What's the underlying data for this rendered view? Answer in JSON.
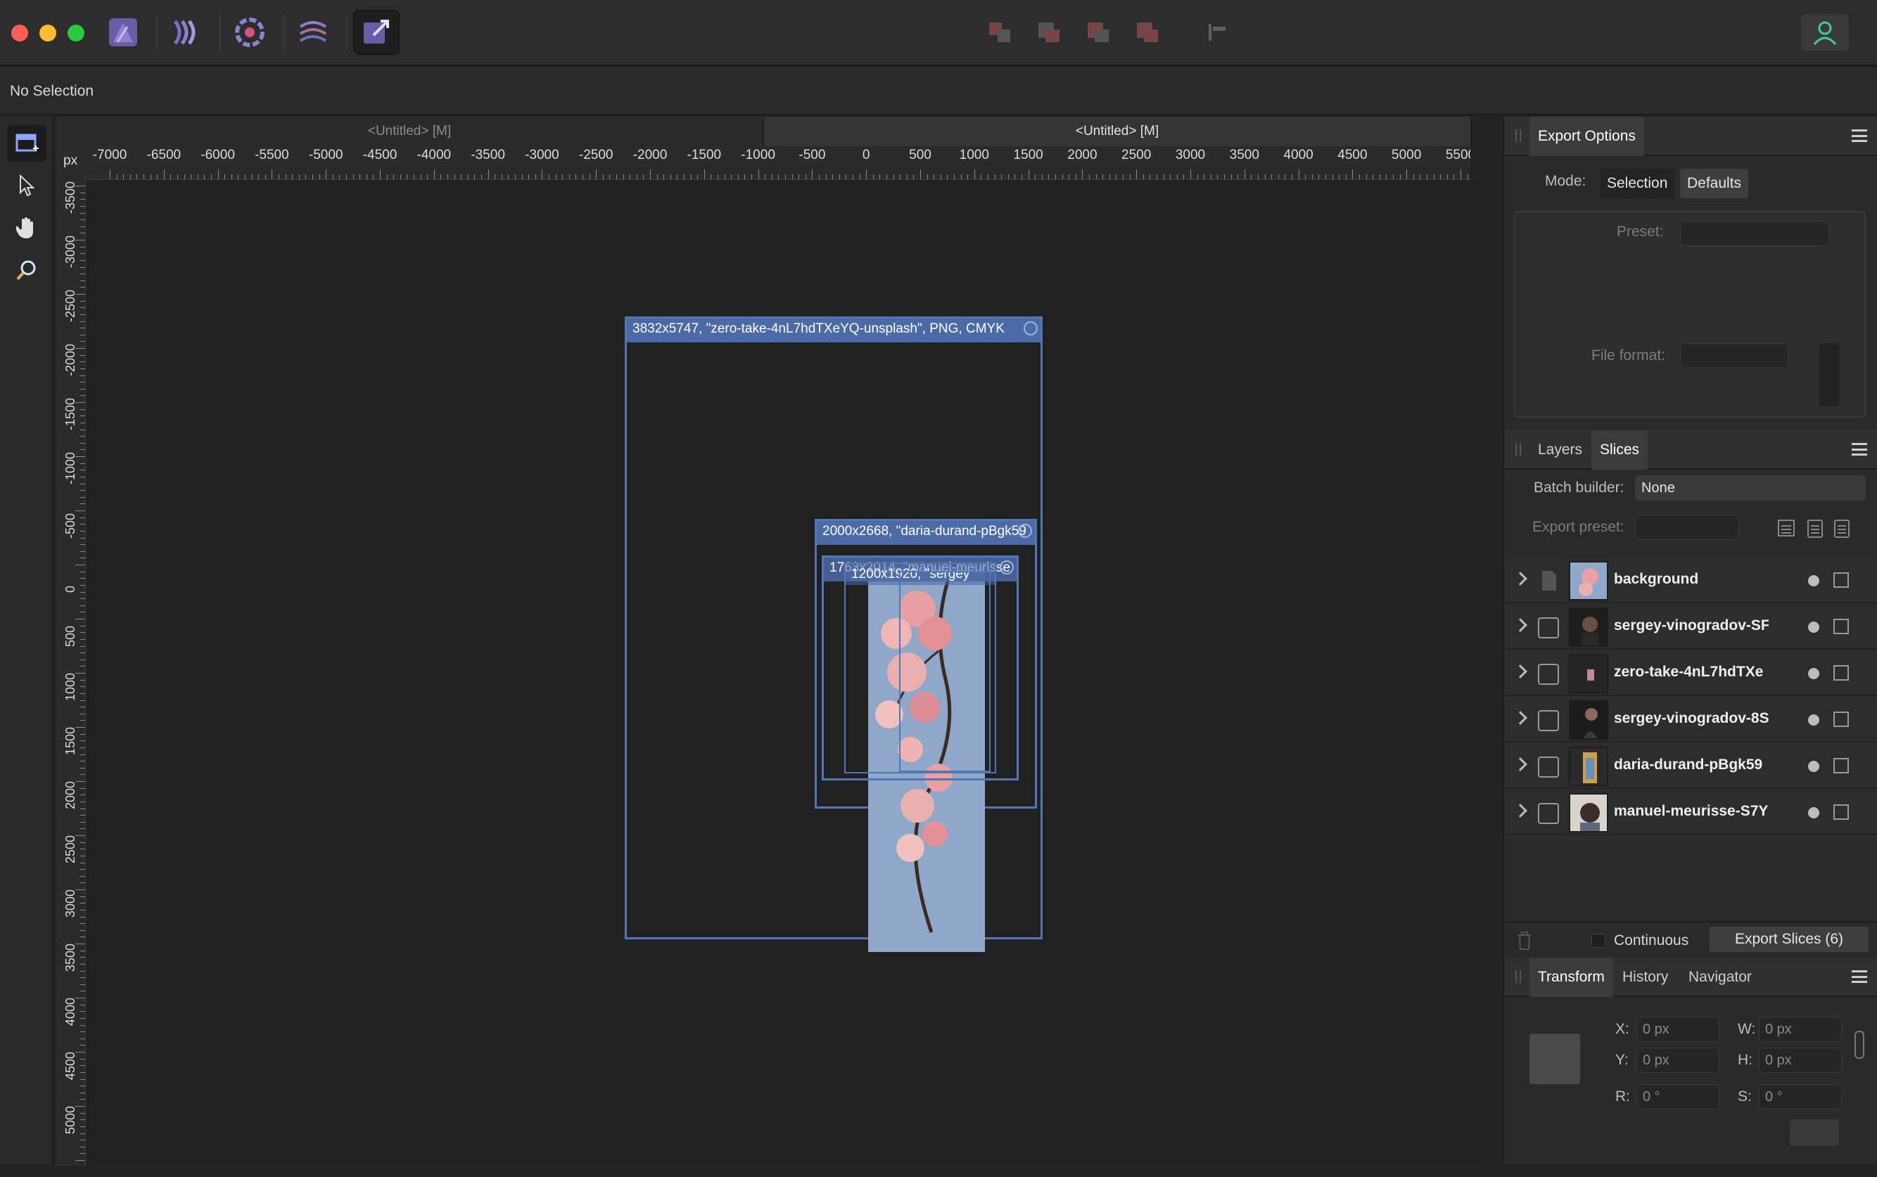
{
  "toolbar": {
    "personas": [
      "photo-persona",
      "liquify-persona",
      "develop-persona",
      "tone-mapping-persona",
      "export-persona"
    ]
  },
  "context": {
    "status": "No Selection"
  },
  "documents": {
    "tabs": [
      "<Untitled> [M]",
      "<Untitled> [M]"
    ],
    "ruler_unit": "px",
    "ruler_x": [
      "-7000",
      "-6500",
      "-6000",
      "-5500",
      "-5000",
      "-4500",
      "-4000",
      "-3500",
      "-3000",
      "-2500",
      "-2000",
      "-1500",
      "-1000",
      "-500",
      "0",
      "500",
      "1000",
      "1500",
      "2000",
      "2500",
      "3000",
      "3500",
      "4000",
      "4500",
      "5000",
      "5500"
    ],
    "ruler_y": [
      "-3500",
      "-3000",
      "-2500",
      "-2000",
      "-1500",
      "-1000",
      "-500",
      "0",
      "500",
      "1000",
      "1500",
      "2000",
      "2500",
      "3000",
      "3500",
      "4000",
      "4500",
      "5000",
      "500"
    ]
  },
  "canvas": {
    "slice_1": "3832x5747, \"zero-take-4nL7hdTXeYQ-unsplash\", PNG, CMYK",
    "slice_2": "2000x2668, \"daria-durand-pBgk59",
    "slice_3": "1763x2014, \"manuel-meurisse",
    "slice_4": "1200x1920, \"sergey"
  },
  "export_options": {
    "title": "Export Options",
    "mode_label": "Mode:",
    "mode_selection": "Selection",
    "mode_defaults": "Defaults",
    "preset_label": "Preset:",
    "file_format_label": "File format:"
  },
  "slices_panel": {
    "tab_layers": "Layers",
    "tab_slices": "Slices",
    "batch_builder_label": "Batch builder:",
    "batch_builder_value": "None",
    "export_preset_label": "Export preset:",
    "rows": [
      {
        "name": "background"
      },
      {
        "name": "sergey-vinogradov-SF"
      },
      {
        "name": "zero-take-4nL7hdTXe"
      },
      {
        "name": "sergey-vinogradov-8S"
      },
      {
        "name": "daria-durand-pBgk59"
      },
      {
        "name": "manuel-meurisse-S7Y"
      }
    ],
    "continuous_label": "Continuous",
    "export_button": "Export Slices (6)"
  },
  "transform": {
    "tab_transform": "Transform",
    "tab_history": "History",
    "tab_navigator": "Navigator",
    "x_label": "X:",
    "x_value": "0 px",
    "y_label": "Y:",
    "y_value": "0 px",
    "w_label": "W:",
    "w_value": "0 px",
    "h_label": "H:",
    "h_value": "0 px",
    "r_label": "R:",
    "r_value": "0 °",
    "s_label": "S:",
    "s_value": "0 °"
  },
  "colors": {
    "accent": "#5377b5",
    "slice_label_bg": "#4b6aa6",
    "background": "#232323"
  }
}
